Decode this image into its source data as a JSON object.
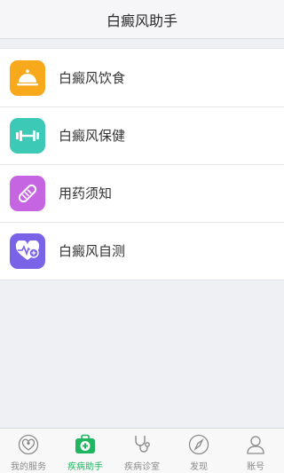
{
  "header": {
    "title": "白癜风助手"
  },
  "menu": {
    "items": [
      {
        "label": "白癜风饮食",
        "icon": "food-cloche-icon",
        "color": "#f7a81b"
      },
      {
        "label": "白癜风保健",
        "icon": "dumbbell-icon",
        "color": "#3cc9b6"
      },
      {
        "label": "用药须知",
        "icon": "pill-icon",
        "color": "#c565e2"
      },
      {
        "label": "白癜风自测",
        "icon": "heart-test-icon",
        "color": "#7a63e6"
      }
    ]
  },
  "tabbar": {
    "active_color": "#20b55f",
    "items": [
      {
        "label": "我的服务",
        "icon": "service-icon"
      },
      {
        "label": "疾病助手",
        "icon": "medical-kit-icon"
      },
      {
        "label": "疾病诊室",
        "icon": "stethoscope-icon"
      },
      {
        "label": "发现",
        "icon": "compass-icon"
      },
      {
        "label": "账号",
        "icon": "user-icon"
      }
    ]
  }
}
